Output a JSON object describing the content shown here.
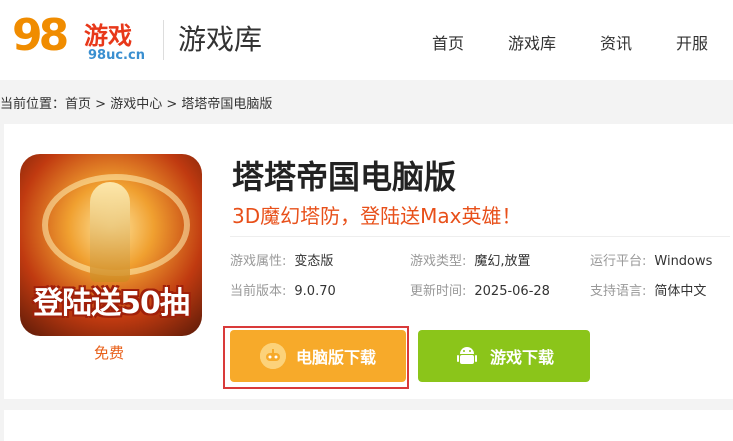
{
  "header": {
    "logo_mark": "98",
    "logo_cn": "游戏",
    "logo_url": "98uc.cn",
    "section_title": "游戏库",
    "nav": [
      "首页",
      "游戏库",
      "资讯",
      "开服"
    ]
  },
  "breadcrumb": {
    "prefix": "当前位置：",
    "items": [
      "首页",
      "游戏中心",
      "塔塔帝国电脑版"
    ],
    "separator": ">"
  },
  "game": {
    "icon_banner": "登陆送50抽",
    "price": "免费",
    "title": "塔塔帝国电脑版",
    "slogan": "3D魔幻塔防，登陆送Max英雄！",
    "info": [
      {
        "key": "游戏属性:",
        "value": "变态版"
      },
      {
        "key": "游戏类型:",
        "value": "魔幻,放置"
      },
      {
        "key": "运行平台:",
        "value": "Windows"
      },
      {
        "key": "当前版本:",
        "value": "9.0.70"
      },
      {
        "key": "更新时间:",
        "value": "2025-06-28"
      },
      {
        "key": "支持语言:",
        "value": "简体中文"
      }
    ],
    "pc_download": "电脑版下载",
    "game_download": "游戏下载"
  },
  "colors": {
    "accent_orange": "#f7aa2a",
    "accent_green": "#8bc51a",
    "slogan_red": "#e8501a",
    "highlight_red": "#d93a3a"
  }
}
